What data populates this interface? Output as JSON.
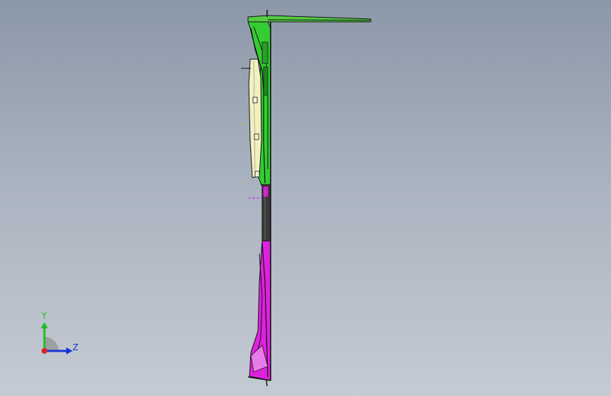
{
  "viewport": {
    "background_top": "#8b98a8",
    "background_bottom": "#c5cbd4"
  },
  "model": {
    "colors": {
      "upper_part": "#33cc33",
      "panel": "#f2efc0",
      "lower_part": "#dd22dd",
      "edges": "#000000"
    }
  },
  "triad": {
    "y_label": "Y",
    "z_label": "Z",
    "y_color": "#1fbf1f",
    "z_color": "#1a33d6",
    "x_color": "#dd2222"
  }
}
